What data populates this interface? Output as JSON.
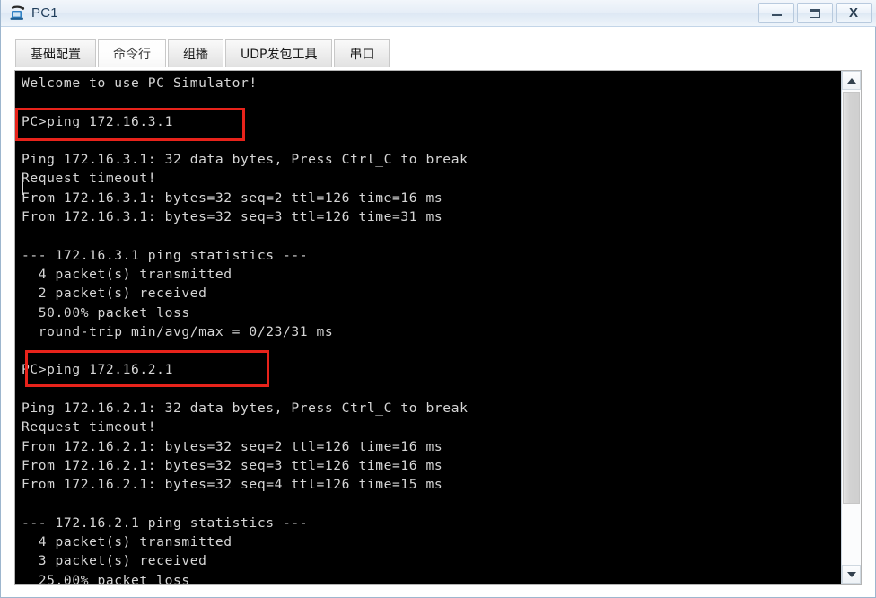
{
  "window": {
    "title": "PC1",
    "icon": "pc-device-icon",
    "buttons": [
      {
        "name": "minimize-button",
        "label": "—",
        "glyph": "minimize-icon"
      },
      {
        "name": "maximize-button",
        "label": "□",
        "glyph": "maximize-icon"
      },
      {
        "name": "close-button",
        "label": "X",
        "glyph": "close-icon"
      }
    ]
  },
  "tabs": [
    {
      "label": "基础配置",
      "name": "tab-basic-config",
      "active": false
    },
    {
      "label": "命令行",
      "name": "tab-command-line",
      "active": true
    },
    {
      "label": "组播",
      "name": "tab-multicast",
      "active": false
    },
    {
      "label": "UDP发包工具",
      "name": "tab-udp-sender",
      "active": false
    },
    {
      "label": "串口",
      "name": "tab-serial-port",
      "active": false
    }
  ],
  "terminal": {
    "text": "Welcome to use PC Simulator!\n\nPC>ping 172.16.3.1\n\nPing 172.16.3.1: 32 data bytes, Press Ctrl_C to break\nRequest timeout!\nFrom 172.16.3.1: bytes=32 seq=2 ttl=126 time=16 ms\nFrom 172.16.3.1: bytes=32 seq=3 ttl=126 time=31 ms\n\n--- 172.16.3.1 ping statistics ---\n  4 packet(s) transmitted\n  2 packet(s) received\n  50.00% packet loss\n  round-trip min/avg/max = 0/23/31 ms\n\nPC>ping 172.16.2.1\n\nPing 172.16.2.1: 32 data bytes, Press Ctrl_C to break\nRequest timeout!\nFrom 172.16.2.1: bytes=32 seq=2 ttl=126 time=16 ms\nFrom 172.16.2.1: bytes=32 seq=3 ttl=126 time=16 ms\nFrom 172.16.2.1: bytes=32 seq=4 ttl=126 time=15 ms\n\n--- 172.16.2.1 ping statistics ---\n  4 packet(s) transmitted\n  3 packet(s) received\n  25.00% packet loss",
    "highlights": [
      {
        "name": "highlight-box-ping-172-16-3-1",
        "command": "PC>ping 172.16.3.1"
      },
      {
        "name": "highlight-box-ping-172-16-2-1",
        "command": "PC>ping 172.16.2.1"
      }
    ],
    "highlight_color": "#e8231b",
    "background_color": "#000000",
    "text_color": "#d6d6d6"
  },
  "scrollbar": {
    "up_arrow": "chevron-up-icon",
    "down_arrow": "chevron-down-icon"
  }
}
